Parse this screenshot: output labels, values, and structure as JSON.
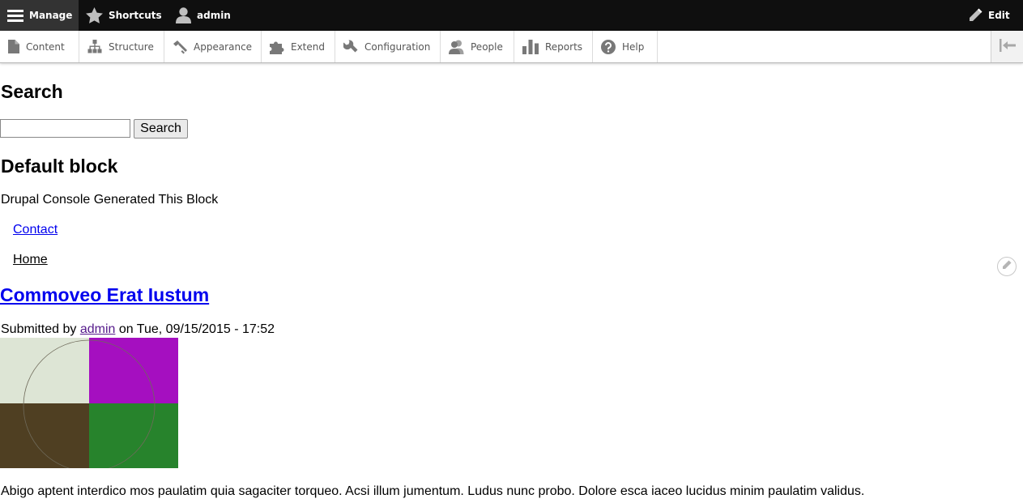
{
  "toolbar": {
    "manage_label": "Manage",
    "shortcuts_label": "Shortcuts",
    "user_label": "admin",
    "edit_label": "Edit"
  },
  "tray": {
    "items": [
      {
        "label": "Content",
        "icon": "file-icon"
      },
      {
        "label": "Structure",
        "icon": "sitemap-icon"
      },
      {
        "label": "Appearance",
        "icon": "paintbrush-icon"
      },
      {
        "label": "Extend",
        "icon": "puzzle-icon"
      },
      {
        "label": "Configuration",
        "icon": "wrench-icon"
      },
      {
        "label": "People",
        "icon": "people-icon"
      },
      {
        "label": "Reports",
        "icon": "bar-chart-icon"
      },
      {
        "label": "Help",
        "icon": "question-icon"
      }
    ],
    "toggle_icon": "collapse-tray-icon"
  },
  "search_block": {
    "title": "Search",
    "input_value": "",
    "button_label": "Search"
  },
  "default_block": {
    "title": "Default block",
    "body": "Drupal Console Generated This Block"
  },
  "menu": {
    "contact": "Contact",
    "home": "Home"
  },
  "article": {
    "title": "Commoveo Erat Iustum",
    "submitted_prefix": "Submitted by ",
    "author": "admin",
    "submitted_suffix": " on Tue, 09/15/2015 - 17:52",
    "image_colors": [
      "#dde5d5",
      "#a50fc0",
      "#4f3f22",
      "#27832c"
    ],
    "body": "Abigo aptent interdico mos paulatim quia sagaciter torqueo. Acsi illum jumentum. Ludus nunc probo. Dolore esca iaceo lucidus minim paulatim validus."
  },
  "colors": {
    "toolbar_bg": "#0f0f0f",
    "manage_bg": "#333333",
    "link": "#0000ee",
    "visited_link": "#551a8b"
  }
}
